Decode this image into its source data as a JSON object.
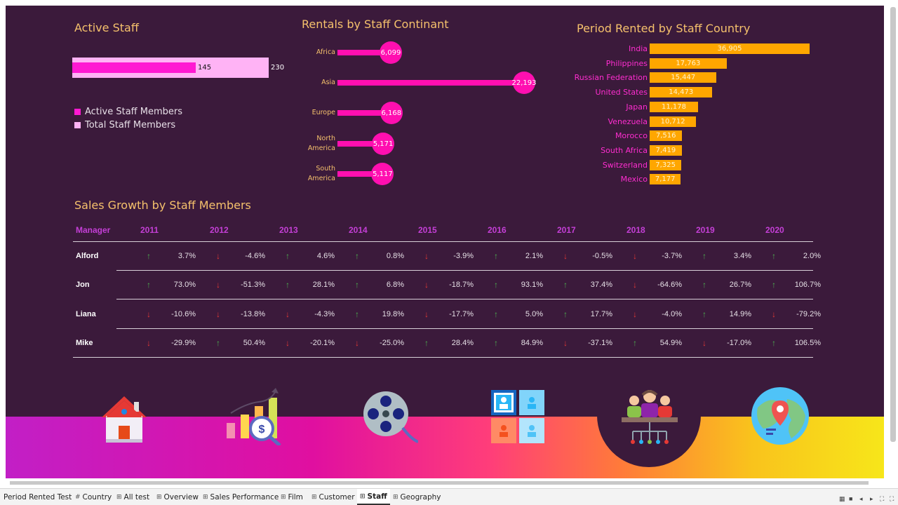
{
  "active_staff": {
    "title": "Active Staff",
    "active_value": "145",
    "total_value": "230",
    "legend": [
      "Active Staff Members",
      "Total Staff Members"
    ],
    "colors": {
      "active": "#ff19d2",
      "total": "#ffb3f5"
    }
  },
  "continent": {
    "title": "Rentals by Staff Continant",
    "items": [
      {
        "label": "Africa",
        "value": "6,099"
      },
      {
        "label": "Asia",
        "value": "22,193"
      },
      {
        "label": "Europe",
        "value": "6,168"
      },
      {
        "label": "North America",
        "value": "5,171"
      },
      {
        "label": "South America",
        "value": "5,117"
      }
    ]
  },
  "country": {
    "title": "Period Rented by Staff Country",
    "items": [
      {
        "label": "India",
        "value": "36,905"
      },
      {
        "label": "Philippines",
        "value": "17,763"
      },
      {
        "label": "Russian Federation",
        "value": "15,447"
      },
      {
        "label": "United States",
        "value": "14,473"
      },
      {
        "label": "Japan",
        "value": "11,178"
      },
      {
        "label": "Venezuela",
        "value": "10,712"
      },
      {
        "label": "Morocco",
        "value": "7,516"
      },
      {
        "label": "South Africa",
        "value": "7,419"
      },
      {
        "label": "Switzerland",
        "value": "7,325"
      },
      {
        "label": "Mexico",
        "value": "7,177"
      }
    ]
  },
  "growth": {
    "title": "Sales Growth by Staff Members",
    "header": "Manager",
    "years": [
      "2011",
      "2012",
      "2013",
      "2014",
      "2015",
      "2016",
      "2017",
      "2018",
      "2019",
      "2020"
    ],
    "rows": [
      {
        "name": "Alford",
        "values": [
          "3.7%",
          "-4.6%",
          "4.6%",
          "0.8%",
          "-3.9%",
          "2.1%",
          "-0.5%",
          "-3.7%",
          "3.4%",
          "2.0%"
        ]
      },
      {
        "name": "Jon",
        "values": [
          "73.0%",
          "-51.3%",
          "28.1%",
          "6.8%",
          "-18.7%",
          "93.1%",
          "37.4%",
          "-64.6%",
          "26.7%",
          "106.7%"
        ]
      },
      {
        "name": "Liana",
        "values": [
          "-10.6%",
          "-13.8%",
          "-4.3%",
          "19.8%",
          "-17.7%",
          "5.0%",
          "17.7%",
          "-4.0%",
          "14.9%",
          "-79.2%"
        ]
      },
      {
        "name": "Mike",
        "values": [
          "-29.9%",
          "50.4%",
          "-20.1%",
          "-25.0%",
          "28.4%",
          "84.9%",
          "-37.1%",
          "54.9%",
          "-17.0%",
          "106.5%"
        ]
      }
    ]
  },
  "nav_icons": [
    "home-icon",
    "sales-performance-icon",
    "film-icon",
    "customer-icon",
    "staff-icon",
    "geography-icon"
  ],
  "tabs": [
    {
      "label": "Period Rented Test",
      "icon": ""
    },
    {
      "label": "Country",
      "icon": "#"
    },
    {
      "label": "All test",
      "icon": "⊞"
    },
    {
      "label": "Overview",
      "icon": "⊞"
    },
    {
      "label": "Sales Performance",
      "icon": "⊞"
    },
    {
      "label": "Film",
      "icon": "⊞"
    },
    {
      "label": "Customer",
      "icon": "⊞"
    },
    {
      "label": "Staff",
      "icon": "⊞"
    },
    {
      "label": "Geography",
      "icon": "⊞"
    }
  ],
  "active_tab": "Staff"
}
